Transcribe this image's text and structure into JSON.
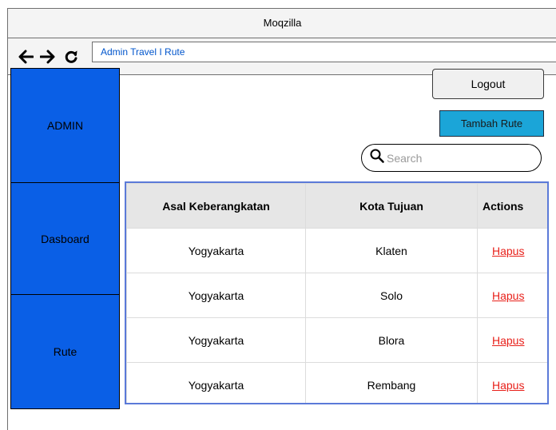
{
  "window": {
    "title": "Moqzilla"
  },
  "navbar": {
    "back_icon": "arrow-left-icon",
    "forward_icon": "arrow-right-icon",
    "reload_icon": "reload-icon",
    "address": "Admin Travel I Rute"
  },
  "sidebar": {
    "items": [
      {
        "label": "ADMIN"
      },
      {
        "label": "Dasboard"
      },
      {
        "label": "Rute"
      }
    ]
  },
  "header": {
    "logout_label": "Logout",
    "add_label": "Tambah Rute",
    "search_placeholder": "Search"
  },
  "table": {
    "columns": [
      "Asal Keberangkatan",
      "Kota Tujuan",
      "Actions"
    ],
    "rows": [
      {
        "asal": "Yogyakarta",
        "tujuan": "Klaten",
        "action": "Hapus"
      },
      {
        "asal": "Yogyakarta",
        "tujuan": "Solo",
        "action": "Hapus"
      },
      {
        "asal": "Yogyakarta",
        "tujuan": "Blora",
        "action": "Hapus"
      },
      {
        "asal": "Yogyakarta",
        "tujuan": "Rembang",
        "action": "Hapus"
      }
    ]
  },
  "colors": {
    "sidebar": "#0a5fe6",
    "add_button": "#1ba5d8",
    "table_border": "#5b7ad8",
    "action_link": "#e8201a",
    "address_text": "#0055cc"
  }
}
